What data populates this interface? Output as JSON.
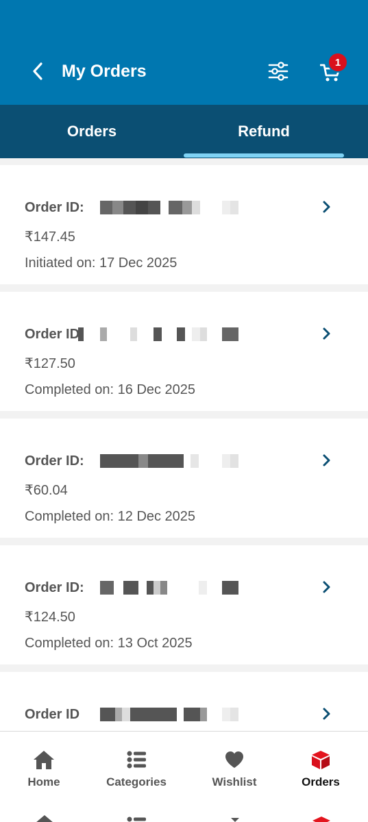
{
  "header": {
    "title": "My Orders",
    "cart_count": "1",
    "colors": {
      "primary": "#0077b0",
      "tab_bar": "#0b4f73",
      "indicator": "#7fd3f5",
      "badge": "#d9101c"
    }
  },
  "tabs": [
    {
      "label": "Orders",
      "active": false
    },
    {
      "label": "Refund",
      "active": true
    }
  ],
  "orders": [
    {
      "label": "Order ID:",
      "amount": "₹147.45",
      "status": "Initiated on: 17 Dec 2025"
    },
    {
      "label": "Order ID",
      "amount": "₹127.50",
      "status": "Completed on: 16 Dec 2025"
    },
    {
      "label": "Order ID:",
      "amount": "₹60.04",
      "status": "Completed on: 12 Dec 2025"
    },
    {
      "label": "Order ID:",
      "amount": "₹124.50",
      "status": "Completed on: 13 Oct 2025"
    },
    {
      "label": "Order ID",
      "amount": "",
      "status": ""
    }
  ],
  "bottom_nav": [
    {
      "label": "Home",
      "icon": "home-icon",
      "active": false
    },
    {
      "label": "Categories",
      "icon": "categories-icon",
      "active": false
    },
    {
      "label": "Wishlist",
      "icon": "heart-icon",
      "active": false
    },
    {
      "label": "Orders",
      "icon": "box-icon",
      "active": true,
      "accent": "#d9101c"
    }
  ]
}
